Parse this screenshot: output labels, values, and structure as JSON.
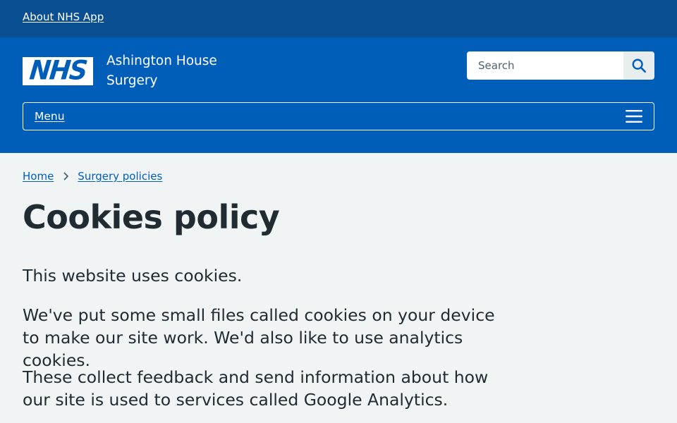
{
  "top_bar": {
    "link_label": "About NHS App"
  },
  "header": {
    "logo_text": "NHS",
    "org_name_line1": "Ashington House",
    "org_name_line2": "Surgery",
    "search": {
      "placeholder": "Search",
      "value": ""
    },
    "menu_label": "Menu"
  },
  "breadcrumb": {
    "items": [
      {
        "label": "Home"
      },
      {
        "label": "Surgery policies"
      }
    ]
  },
  "main": {
    "title": "Cookies policy",
    "paragraphs": [
      "This website uses cookies.",
      "We've put some small files called cookies on your device to make our site work. We'd also like to use analytics cookies.",
      "These collect feedback and send information about how our site is used to services called Google Analytics."
    ]
  },
  "colors": {
    "nhs_blue": "#005eb8",
    "dark_blue": "#0b4f93",
    "page_background": "#f0f4f5",
    "text": "#212b32"
  },
  "icons": {
    "search": "search-icon",
    "menu": "hamburger-menu-icon",
    "breadcrumb_separator": "chevron-right-icon"
  }
}
